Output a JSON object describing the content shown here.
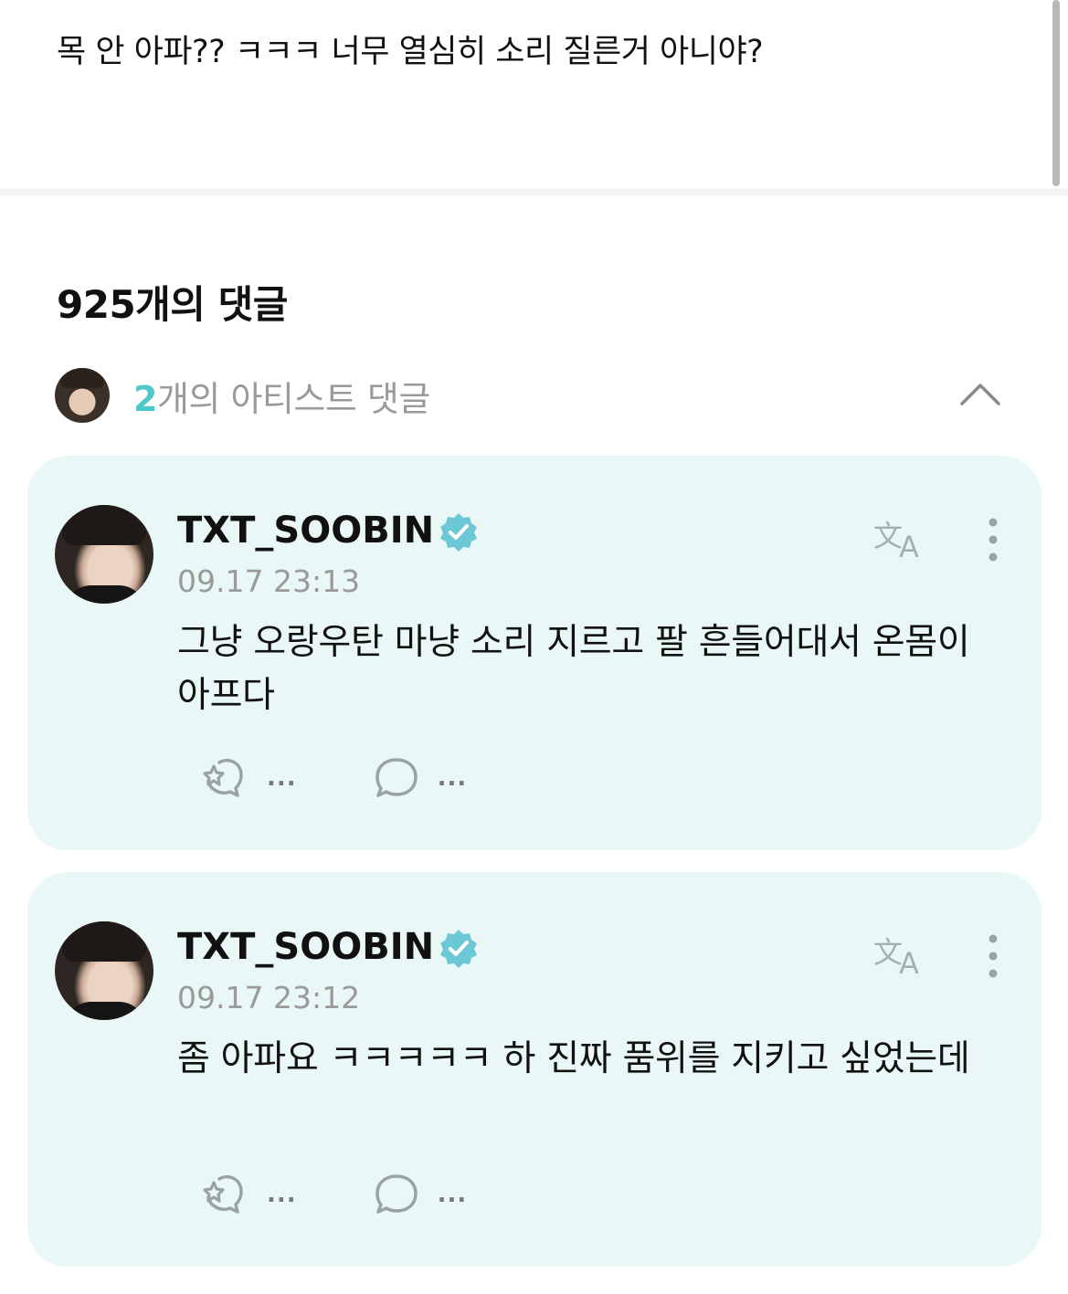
{
  "post": {
    "text": "목 안 아파?? ㅋㅋㅋ 너무 열심히 소리 질른거 아니야?"
  },
  "comments_header": {
    "title": "925개의 댓글"
  },
  "artist_comments": {
    "count": "2",
    "label": "개의 아티스트 댓글",
    "icon": "chevron-up-icon"
  },
  "comments": [
    {
      "username": "TXT_SOOBIN",
      "verified": true,
      "timestamp": "09.17 23:13",
      "body": "그냥 오랑우탄 마냥 소리 지르고 팔 흔들어대서 온몸이 아프다",
      "like_count": "...",
      "reply_count": "..."
    },
    {
      "username": "TXT_SOOBIN",
      "verified": true,
      "timestamp": "09.17 23:12",
      "body": "좀 아파요 ㅋㅋㅋㅋㅋ 하 진짜 품위를 지키고 싶었는데",
      "like_count": "...",
      "reply_count": "..."
    }
  ],
  "colors": {
    "accent": "#4fc8c8",
    "card_bg": "#e9f8f6",
    "verified_badge": "#6cc8d6",
    "muted_text": "#9a9a9a"
  }
}
